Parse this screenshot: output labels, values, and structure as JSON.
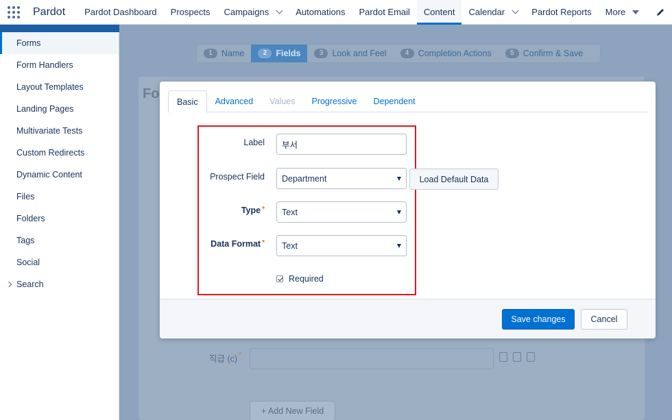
{
  "topnav": {
    "app_name": "Pardot",
    "items": [
      {
        "label": "Pardot Dashboard"
      },
      {
        "label": "Prospects"
      },
      {
        "label": "Campaigns"
      },
      {
        "label": "Automations"
      },
      {
        "label": "Pardot Email"
      },
      {
        "label": "Content"
      },
      {
        "label": "Calendar"
      },
      {
        "label": "Pardot Reports"
      },
      {
        "label": "More"
      }
    ],
    "active": "Content"
  },
  "sidebar": {
    "items": [
      {
        "label": "Forms"
      },
      {
        "label": "Form Handlers"
      },
      {
        "label": "Layout Templates"
      },
      {
        "label": "Landing Pages"
      },
      {
        "label": "Multivariate Tests"
      },
      {
        "label": "Custom Redirects"
      },
      {
        "label": "Dynamic Content"
      },
      {
        "label": "Files"
      },
      {
        "label": "Folders"
      },
      {
        "label": "Tags"
      },
      {
        "label": "Social"
      },
      {
        "label": "Search"
      }
    ],
    "active": "Forms"
  },
  "wizard": {
    "steps": [
      {
        "num": "1",
        "label": "Name"
      },
      {
        "num": "2",
        "label": "Fields"
      },
      {
        "num": "3",
        "label": "Look and Feel"
      },
      {
        "num": "4",
        "label": "Completion Actions"
      },
      {
        "num": "5",
        "label": "Confirm & Save"
      }
    ],
    "current": "Fields"
  },
  "background": {
    "heading_fragment": "Fo",
    "field_label": "직급 (c)",
    "add_field_label": "+ Add New Field"
  },
  "modal": {
    "tabs": [
      {
        "label": "Basic"
      },
      {
        "label": "Advanced"
      },
      {
        "label": "Values"
      },
      {
        "label": "Progressive"
      },
      {
        "label": "Dependent"
      }
    ],
    "active_tab": "Basic",
    "fields": {
      "label": {
        "label": "Label",
        "value": "부서"
      },
      "prospect_field": {
        "label": "Prospect Field",
        "value": "Department"
      },
      "type": {
        "label": "Type",
        "value": "Text"
      },
      "data_format": {
        "label": "Data Format",
        "value": "Text"
      },
      "required": {
        "label": "Required",
        "checked": true
      }
    },
    "load_default_label": "Load Default Data",
    "save_label": "Save changes",
    "cancel_label": "Cancel",
    "required_marker": "*"
  },
  "colors": {
    "accent": "#0070d2",
    "highlight_box": "#e0161d"
  }
}
